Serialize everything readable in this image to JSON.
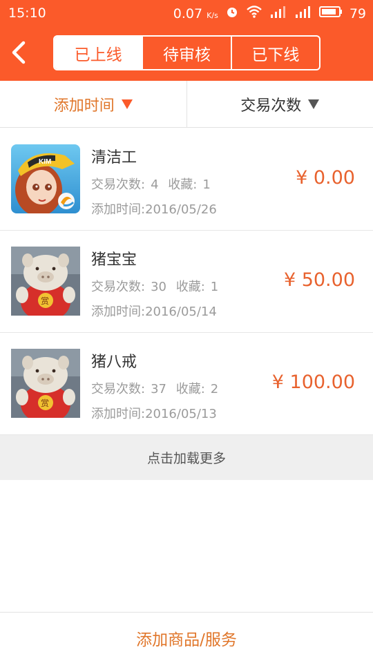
{
  "status_bar": {
    "time": "15:10",
    "net_speed": "0.07",
    "net_unit": "K/s",
    "battery": "79"
  },
  "header": {
    "tabs": [
      "已上线",
      "待审核",
      "已下线"
    ],
    "active_tab": 0,
    "accent_color": "#fb5a2a"
  },
  "sort_bar": {
    "items": [
      {
        "label": "添加时间"
      },
      {
        "label": "交易次数"
      }
    ]
  },
  "items": [
    {
      "name": "清洁工",
      "trades_label": "交易次数:",
      "trades": "4",
      "fav_label": "收藏:",
      "favs": "1",
      "date_label": "添加时间:",
      "date": "2016/05/26",
      "price": "¥ 0.00",
      "thumb": "game-character-icon"
    },
    {
      "name": "猪宝宝",
      "trades_label": "交易次数:",
      "trades": "30",
      "fav_label": "收藏:",
      "favs": "1",
      "date_label": "添加时间:",
      "date": "2016/05/14",
      "price": "¥ 50.00",
      "thumb": "plush-pig-photo"
    },
    {
      "name": "猪八戒",
      "trades_label": "交易次数:",
      "trades": "37",
      "fav_label": "收藏:",
      "favs": "2",
      "date_label": "添加时间:",
      "date": "2016/05/13",
      "price": "¥ 100.00",
      "thumb": "plush-pig-photo"
    }
  ],
  "load_more": "点击加载更多",
  "footer": {
    "add_label": "添加商品/服务"
  }
}
